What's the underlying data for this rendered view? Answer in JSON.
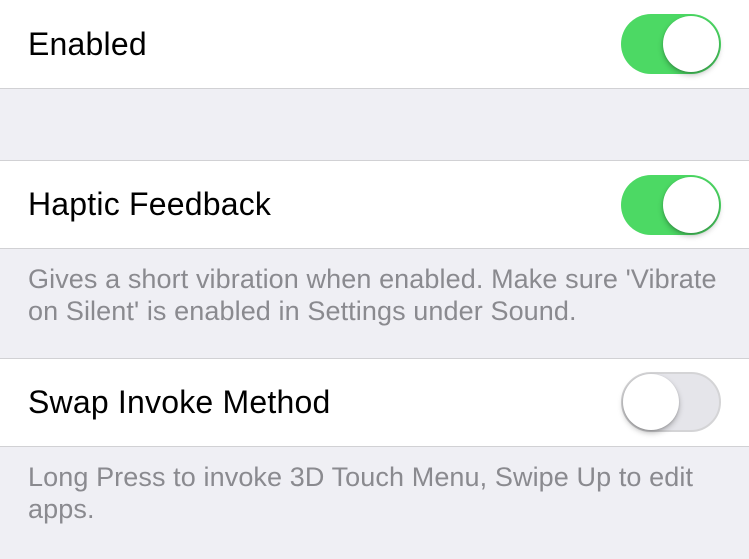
{
  "sections": {
    "enabled": {
      "label": "Enabled",
      "value": true
    },
    "haptic": {
      "label": "Haptic Feedback",
      "value": true,
      "footer": "Gives a short vibration when enabled. Make sure 'Vibrate on Silent' is enabled in Settings under Sound."
    },
    "swap": {
      "label": "Swap Invoke Method",
      "value": false,
      "footer": "Long Press to invoke 3D Touch Menu, Swipe Up to edit apps."
    }
  }
}
